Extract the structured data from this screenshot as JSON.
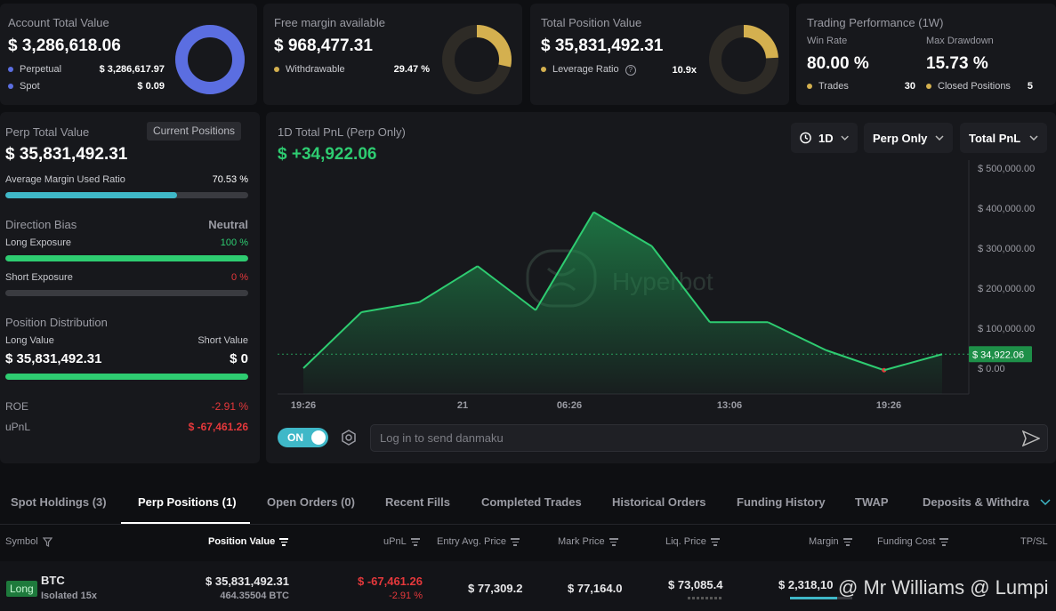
{
  "account": {
    "title": "Account Total Value",
    "value": "$ 3,286,618.06",
    "perp_label": "Perpetual",
    "perp_value": "$ 3,286,617.97",
    "spot_label": "Spot",
    "spot_value": "$ 0.09",
    "donut_fraction": 1.0,
    "color": "#5b6ee1"
  },
  "margin": {
    "title": "Free margin available",
    "value": "$ 968,477.31",
    "withdraw_label": "Withdrawable",
    "withdraw_value": "29.47 %",
    "donut_fraction": 0.2947,
    "color": "#d4b04f"
  },
  "position": {
    "title": "Total Position Value",
    "value": "$ 35,831,492.31",
    "leverage_label": "Leverage Ratio",
    "leverage_value": "10.9x",
    "donut_fraction": 0.25,
    "color": "#d4b04f"
  },
  "performance": {
    "title": "Trading Performance (1W)",
    "winrate_label": "Win Rate",
    "winrate_value": "80.00 %",
    "drawdown_label": "Max Drawdown",
    "drawdown_value": "15.73 %",
    "trades_label": "Trades",
    "trades_value": "30",
    "closed_label": "Closed Positions",
    "closed_value": "5"
  },
  "perp": {
    "title": "Perp Total Value",
    "button": "Current Positions",
    "value": "$ 35,831,492.31",
    "avg_margin_label": "Average Margin Used Ratio",
    "avg_margin_value": "70.53 %",
    "avg_margin_fraction": 0.7053,
    "bias_label": "Direction Bias",
    "bias_value": "Neutral",
    "long_exp_label": "Long Exposure",
    "long_exp_value": "100 %",
    "long_exp_fraction": 1.0,
    "short_exp_label": "Short Exposure",
    "short_exp_value": "0 %",
    "short_exp_fraction": 0.0,
    "dist_label": "Position Distribution",
    "long_value_label": "Long Value",
    "long_value": "$ 35,831,492.31",
    "short_value_label": "Short Value",
    "short_value": "$ 0",
    "roe_label": "ROE",
    "roe_value": "-2.91 %",
    "upnl_label": "uPnL",
    "upnl_value": "$ -67,461.26"
  },
  "pnl": {
    "title": "1D Total PnL (Perp Only)",
    "value": "$ +34,922.06",
    "period": "1D",
    "scope": "Perp Only",
    "metric": "Total PnL",
    "watermark": "Hyperbot",
    "danmaku_toggle": "ON",
    "danmaku_placeholder": "Log in to send danmaku"
  },
  "chart_data": {
    "type": "area",
    "x_ticks": [
      "19:26",
      "21",
      "06:26",
      "13:06",
      "19:26"
    ],
    "y_ticks": [
      "$ 0.00",
      "$ 100,000.00",
      "$ 200,000.00",
      "$ 300,000.00",
      "$ 400,000.00",
      "$ 500,000.00"
    ],
    "ylim": [
      0,
      500000
    ],
    "x": [
      0,
      1,
      2,
      3,
      4,
      5,
      6,
      7,
      8,
      9,
      10,
      11
    ],
    "values": [
      0,
      140000,
      165000,
      255000,
      145000,
      390000,
      305000,
      115000,
      115000,
      45000,
      -5000,
      35000
    ],
    "current_label": "$ 34,922.06",
    "current_value": 34922.06,
    "color": "#2ecc71"
  },
  "tabs": [
    {
      "label": "Spot Holdings (3)"
    },
    {
      "label": "Perp Positions (1)"
    },
    {
      "label": "Open Orders (0)"
    },
    {
      "label": "Recent Fills"
    },
    {
      "label": "Completed Trades"
    },
    {
      "label": "Historical Orders"
    },
    {
      "label": "Funding History"
    },
    {
      "label": "TWAP"
    },
    {
      "label": "Deposits & Withdraw"
    }
  ],
  "table": {
    "headers": [
      "Symbol",
      "Position Value",
      "uPnL",
      "Entry Avg. Price",
      "Mark Price",
      "Liq. Price",
      "Margin",
      "Funding Cost",
      "TP/SL"
    ],
    "row": {
      "side": "Long",
      "symbol": "BTC",
      "mode": "Isolated 15x",
      "position_value": "$ 35,831,492.31",
      "position_size": "464.35504 BTC",
      "upnl": "$ -67,461.26",
      "upnl_pct": "-2.91 %",
      "entry": "$ 77,309.2",
      "mark": "$ 77,164.0",
      "liq": "$ 73,085.4",
      "margin": "$ 2,318,10"
    }
  },
  "overlay": {
    "watermark": "@ Mr Williams @ Lumpi"
  }
}
